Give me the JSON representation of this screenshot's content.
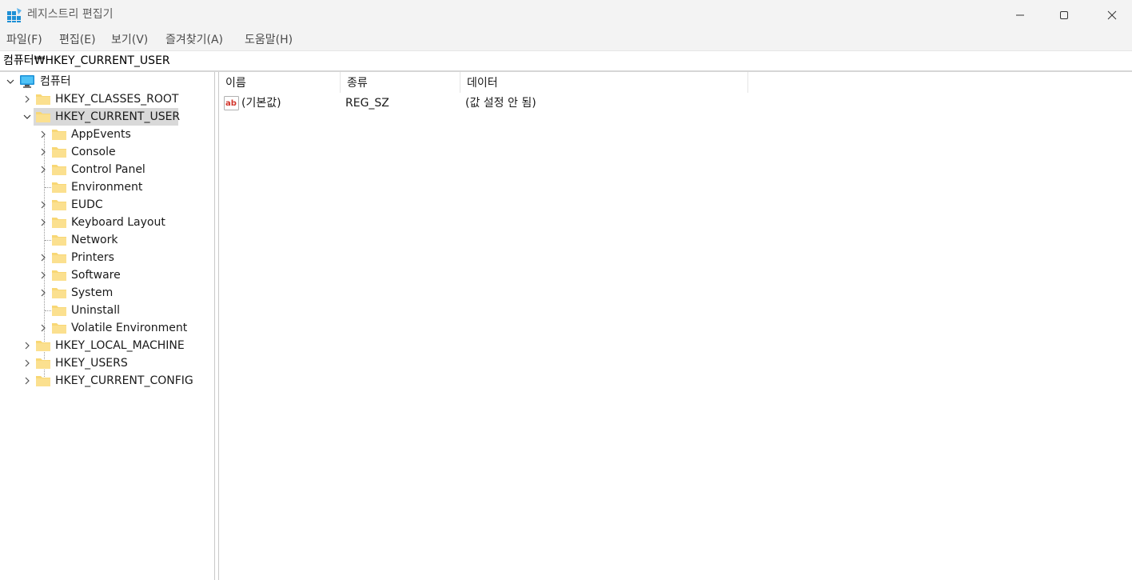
{
  "window": {
    "title": "레지스트리 편집기",
    "icon": "registry-editor-icon"
  },
  "menu": [
    "파일(F)",
    "편집(E)",
    "보기(V)",
    "즐겨찾기(A)",
    "도움말(H)"
  ],
  "address": "컴퓨터₩HKEY_CURRENT_USER",
  "tree": {
    "root": "컴퓨터",
    "hives": {
      "classes_root": "HKEY_CLASSES_ROOT",
      "current_user": "HKEY_CURRENT_USER",
      "local_machine": "HKEY_LOCAL_MACHINE",
      "users": "HKEY_USERS",
      "current_config": "HKEY_CURRENT_CONFIG"
    },
    "current_user_children": [
      "AppEvents",
      "Console",
      "Control Panel",
      "Environment",
      "EUDC",
      "Keyboard Layout",
      "Network",
      "Printers",
      "Software",
      "System",
      "Uninstall",
      "Volatile Environment"
    ]
  },
  "list": {
    "columns": [
      "이름",
      "종류",
      "데이터"
    ],
    "rows": [
      {
        "name": "(기본값)",
        "type": "REG_SZ",
        "data": "(값 설정 안 됨)"
      }
    ]
  },
  "colors": {
    "titlebar": "#f3f3f3",
    "selection": "#d9d9d9",
    "folder": "#f8d775"
  }
}
